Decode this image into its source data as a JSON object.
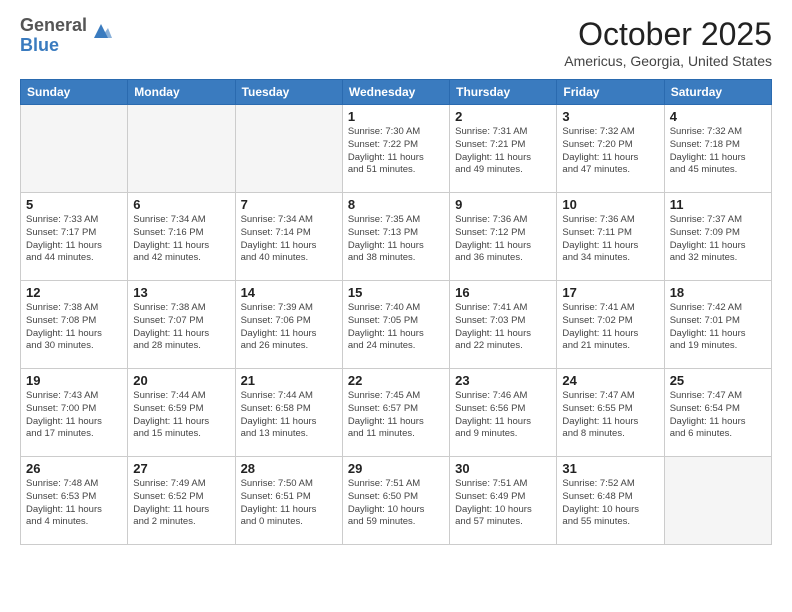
{
  "header": {
    "logo_general": "General",
    "logo_blue": "Blue",
    "month": "October 2025",
    "location": "Americus, Georgia, United States"
  },
  "weekdays": [
    "Sunday",
    "Monday",
    "Tuesday",
    "Wednesday",
    "Thursday",
    "Friday",
    "Saturday"
  ],
  "weeks": [
    [
      {
        "day": "",
        "info": ""
      },
      {
        "day": "",
        "info": ""
      },
      {
        "day": "",
        "info": ""
      },
      {
        "day": "1",
        "info": "Sunrise: 7:30 AM\nSunset: 7:22 PM\nDaylight: 11 hours\nand 51 minutes."
      },
      {
        "day": "2",
        "info": "Sunrise: 7:31 AM\nSunset: 7:21 PM\nDaylight: 11 hours\nand 49 minutes."
      },
      {
        "day": "3",
        "info": "Sunrise: 7:32 AM\nSunset: 7:20 PM\nDaylight: 11 hours\nand 47 minutes."
      },
      {
        "day": "4",
        "info": "Sunrise: 7:32 AM\nSunset: 7:18 PM\nDaylight: 11 hours\nand 45 minutes."
      }
    ],
    [
      {
        "day": "5",
        "info": "Sunrise: 7:33 AM\nSunset: 7:17 PM\nDaylight: 11 hours\nand 44 minutes."
      },
      {
        "day": "6",
        "info": "Sunrise: 7:34 AM\nSunset: 7:16 PM\nDaylight: 11 hours\nand 42 minutes."
      },
      {
        "day": "7",
        "info": "Sunrise: 7:34 AM\nSunset: 7:14 PM\nDaylight: 11 hours\nand 40 minutes."
      },
      {
        "day": "8",
        "info": "Sunrise: 7:35 AM\nSunset: 7:13 PM\nDaylight: 11 hours\nand 38 minutes."
      },
      {
        "day": "9",
        "info": "Sunrise: 7:36 AM\nSunset: 7:12 PM\nDaylight: 11 hours\nand 36 minutes."
      },
      {
        "day": "10",
        "info": "Sunrise: 7:36 AM\nSunset: 7:11 PM\nDaylight: 11 hours\nand 34 minutes."
      },
      {
        "day": "11",
        "info": "Sunrise: 7:37 AM\nSunset: 7:09 PM\nDaylight: 11 hours\nand 32 minutes."
      }
    ],
    [
      {
        "day": "12",
        "info": "Sunrise: 7:38 AM\nSunset: 7:08 PM\nDaylight: 11 hours\nand 30 minutes."
      },
      {
        "day": "13",
        "info": "Sunrise: 7:38 AM\nSunset: 7:07 PM\nDaylight: 11 hours\nand 28 minutes."
      },
      {
        "day": "14",
        "info": "Sunrise: 7:39 AM\nSunset: 7:06 PM\nDaylight: 11 hours\nand 26 minutes."
      },
      {
        "day": "15",
        "info": "Sunrise: 7:40 AM\nSunset: 7:05 PM\nDaylight: 11 hours\nand 24 minutes."
      },
      {
        "day": "16",
        "info": "Sunrise: 7:41 AM\nSunset: 7:03 PM\nDaylight: 11 hours\nand 22 minutes."
      },
      {
        "day": "17",
        "info": "Sunrise: 7:41 AM\nSunset: 7:02 PM\nDaylight: 11 hours\nand 21 minutes."
      },
      {
        "day": "18",
        "info": "Sunrise: 7:42 AM\nSunset: 7:01 PM\nDaylight: 11 hours\nand 19 minutes."
      }
    ],
    [
      {
        "day": "19",
        "info": "Sunrise: 7:43 AM\nSunset: 7:00 PM\nDaylight: 11 hours\nand 17 minutes."
      },
      {
        "day": "20",
        "info": "Sunrise: 7:44 AM\nSunset: 6:59 PM\nDaylight: 11 hours\nand 15 minutes."
      },
      {
        "day": "21",
        "info": "Sunrise: 7:44 AM\nSunset: 6:58 PM\nDaylight: 11 hours\nand 13 minutes."
      },
      {
        "day": "22",
        "info": "Sunrise: 7:45 AM\nSunset: 6:57 PM\nDaylight: 11 hours\nand 11 minutes."
      },
      {
        "day": "23",
        "info": "Sunrise: 7:46 AM\nSunset: 6:56 PM\nDaylight: 11 hours\nand 9 minutes."
      },
      {
        "day": "24",
        "info": "Sunrise: 7:47 AM\nSunset: 6:55 PM\nDaylight: 11 hours\nand 8 minutes."
      },
      {
        "day": "25",
        "info": "Sunrise: 7:47 AM\nSunset: 6:54 PM\nDaylight: 11 hours\nand 6 minutes."
      }
    ],
    [
      {
        "day": "26",
        "info": "Sunrise: 7:48 AM\nSunset: 6:53 PM\nDaylight: 11 hours\nand 4 minutes."
      },
      {
        "day": "27",
        "info": "Sunrise: 7:49 AM\nSunset: 6:52 PM\nDaylight: 11 hours\nand 2 minutes."
      },
      {
        "day": "28",
        "info": "Sunrise: 7:50 AM\nSunset: 6:51 PM\nDaylight: 11 hours\nand 0 minutes."
      },
      {
        "day": "29",
        "info": "Sunrise: 7:51 AM\nSunset: 6:50 PM\nDaylight: 10 hours\nand 59 minutes."
      },
      {
        "day": "30",
        "info": "Sunrise: 7:51 AM\nSunset: 6:49 PM\nDaylight: 10 hours\nand 57 minutes."
      },
      {
        "day": "31",
        "info": "Sunrise: 7:52 AM\nSunset: 6:48 PM\nDaylight: 10 hours\nand 55 minutes."
      },
      {
        "day": "",
        "info": ""
      }
    ]
  ]
}
